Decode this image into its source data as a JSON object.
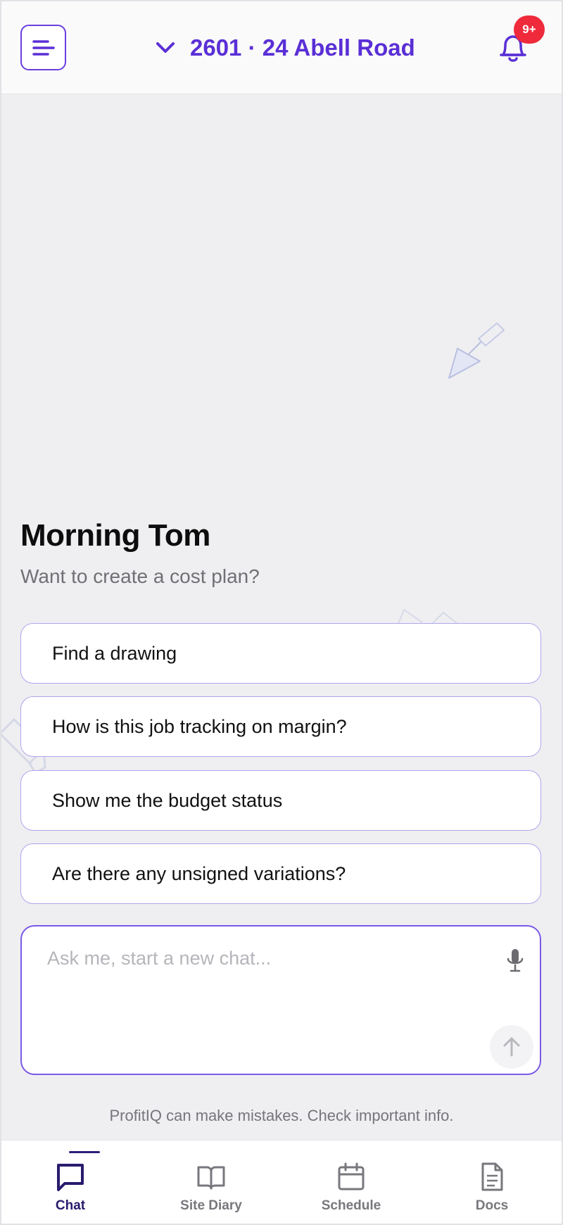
{
  "header": {
    "menu_icon": "menu-icon",
    "project_title": "2601 · 24 Abell Road",
    "chevron_icon": "chevron-down-icon",
    "bell_icon": "bell-icon",
    "notification_badge": "9+"
  },
  "greeting": {
    "title": "Morning Tom",
    "subtitle": "Want to create a cost plan?"
  },
  "suggestions": [
    {
      "label": "Find a drawing"
    },
    {
      "label": "How is this job tracking on margin?"
    },
    {
      "label": "Show me the budget status"
    },
    {
      "label": "Are there any unsigned variations?"
    }
  ],
  "chat": {
    "placeholder": "Ask me, start a new chat...",
    "mic_icon": "mic-icon",
    "send_icon": "arrow-up-icon"
  },
  "disclaimer": "ProfitIQ can make mistakes. Check important info.",
  "nav": {
    "items": [
      {
        "label": "Chat",
        "icon": "chat-icon",
        "active": true
      },
      {
        "label": "Site Diary",
        "icon": "book-icon",
        "active": false
      },
      {
        "label": "Schedule",
        "icon": "calendar-icon",
        "active": false
      },
      {
        "label": "Docs",
        "icon": "document-icon",
        "active": false
      }
    ]
  },
  "colors": {
    "accent": "#5a2fd6",
    "badge": "#ee2a3b",
    "background": "#efeff2",
    "nav_active": "#2a1b6e"
  }
}
